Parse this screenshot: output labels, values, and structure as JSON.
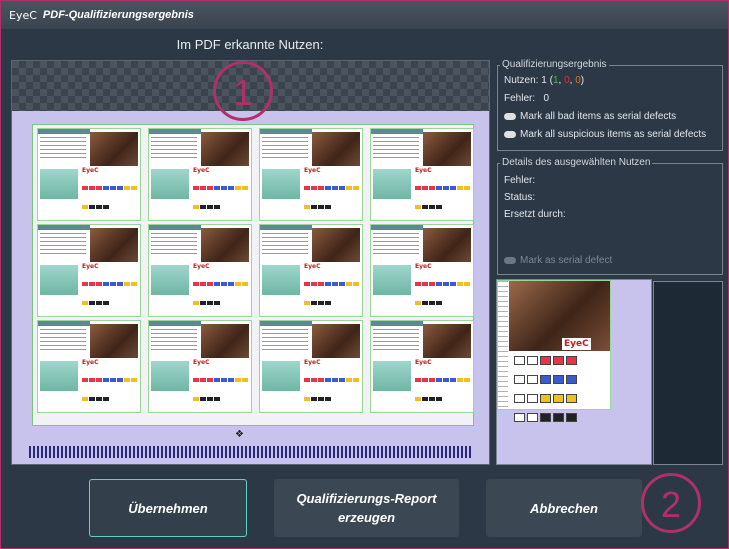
{
  "window": {
    "logo_text": "EyeC",
    "title": "PDF-Qualifizierungsergebnis"
  },
  "viewer": {
    "heading": "Im PDF erkannte Nutzen:",
    "tile_logo": "EyeC"
  },
  "annotations": {
    "badge1": "1",
    "badge2": "2"
  },
  "qualification": {
    "legend": "Qualifizierungsergebnis",
    "nutzen_label": "Nutzen:",
    "nutzen_total": "1",
    "nutzen_open": "(",
    "nutzen_good": "1",
    "sep1": ",",
    "nutzen_bad": "0",
    "sep2": ",",
    "nutzen_suspicious": "0",
    "nutzen_close": ")",
    "fehler_label": "Fehler:",
    "fehler_value": "0",
    "mark_bad": "Mark all bad items as serial defects",
    "mark_suspicious": "Mark all suspicious items as serial defects"
  },
  "details": {
    "legend": "Details des ausgewählten Nutzen",
    "fehler_label": "Fehler:",
    "status_label": "Status:",
    "ersetzt_label": "Ersetzt durch:",
    "mark_serial": "Mark as serial defect"
  },
  "buttons": {
    "apply": "Übernehmen",
    "report_line1": "Qualifizierungs-Report",
    "report_line2": "erzeugen",
    "cancel": "Abbrechen"
  },
  "colors": {
    "accent": "#b0306a",
    "primary_border": "#5fd0c5",
    "good": "#3ec43e",
    "bad": "#e03030",
    "suspicious": "#e07a20"
  }
}
